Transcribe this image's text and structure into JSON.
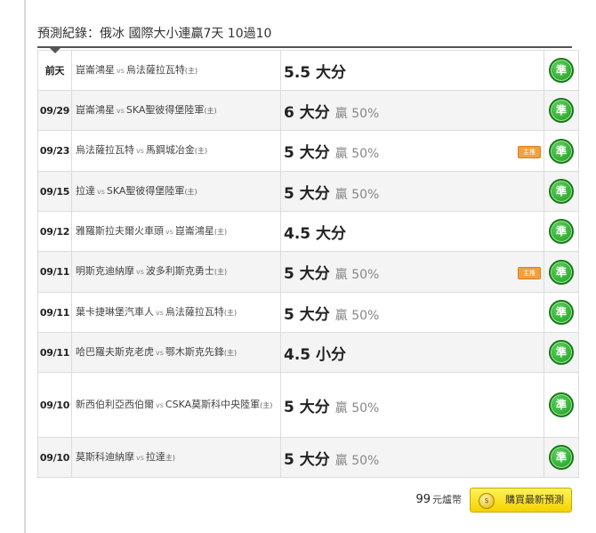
{
  "header": {
    "title": "預測紀錄：俄冰 國際大小連贏7天 10過10"
  },
  "vs_text": "vs",
  "rows": [
    {
      "date": "前天",
      "home": "崑崙鴻星",
      "away": "烏法薩拉瓦特",
      "host": "(主)",
      "pick": "5.5 大分",
      "result": "",
      "badge": ""
    },
    {
      "date": "09/29",
      "home": "崑崙鴻星",
      "away": "SKA聖彼得堡陸軍",
      "host": "(主)",
      "pick": "6 大分",
      "result": "贏 50%",
      "badge": ""
    },
    {
      "date": "09/23",
      "home": "烏法薩拉瓦特",
      "away": "馬鋼城冶金",
      "host": "(主)",
      "pick": "5 大分",
      "result": "贏 50%",
      "badge": "主推"
    },
    {
      "date": "09/15",
      "home": "拉達",
      "away": "SKA聖彼得堡陸軍",
      "host": "(主)",
      "pick": "5 大分",
      "result": "贏 50%",
      "badge": ""
    },
    {
      "date": "09/12",
      "home": "雅羅斯拉夫爾火車頭",
      "away": "崑崙鴻星",
      "host": "(主)",
      "pick": "4.5 大分",
      "result": "",
      "badge": ""
    },
    {
      "date": "09/11",
      "home": "明斯克迪納摩",
      "away": "波多利斯克勇士",
      "host": "(主)",
      "pick": "5 大分",
      "result": "贏 50%",
      "badge": "主推"
    },
    {
      "date": "09/11",
      "home": "葉卡捷琳堡汽車人",
      "away": "烏法薩拉瓦特",
      "host": "(主)",
      "pick": "5 大分",
      "result": "贏 50%",
      "badge": ""
    },
    {
      "date": "09/11",
      "home": "哈巴羅夫斯克老虎",
      "away": "鄂木斯克先鋒",
      "host": "(主)",
      "pick": "4.5 小分",
      "result": "",
      "badge": ""
    },
    {
      "date": "09/10",
      "home": "新西伯利亞西伯爾",
      "away": "CSKA莫斯科中央陸軍",
      "host": "(主)",
      "pick": "5 大分",
      "result": "贏 50%",
      "badge": ""
    },
    {
      "date": "09/10",
      "home": "莫斯科迪納摩",
      "away": "拉達",
      "host": "主)",
      "pick": "5 大分",
      "result": "贏 50%",
      "badge": ""
    }
  ],
  "accurate_mark": "準",
  "footer": {
    "price": "99",
    "unit": "元爐幣",
    "buy_label": "購買最新預測",
    "coin_glyph": "$"
  }
}
